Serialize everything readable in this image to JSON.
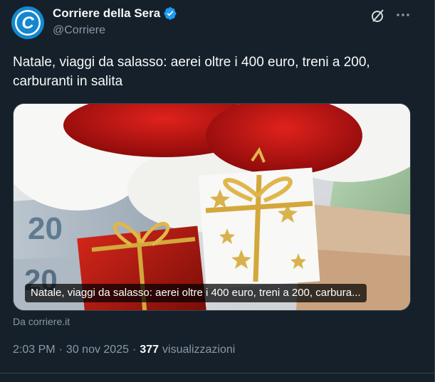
{
  "author": {
    "name": "Corriere della Sera",
    "handle": "@Corriere",
    "avatar_letter": "C",
    "verified": true
  },
  "header_icons": [
    "grok-icon",
    "more-icon"
  ],
  "tweet": {
    "text": "Natale, viaggi da salasso: aerei oltre i 400 euro, treni a 200, carburanti in salita"
  },
  "card": {
    "caption": "Natale, viaggi da salasso: aerei oltre i 400 euro, treni a 200, carbura...",
    "source": "Da corriere.it",
    "banknote_label": "20"
  },
  "meta": {
    "time": "2:03 PM",
    "date": "30 nov 2025",
    "separator": "·",
    "views_count": "377",
    "views_label": "visualizzazioni"
  },
  "colors": {
    "background": "#15202b",
    "text_primary": "#f7f9f9",
    "text_secondary": "#8b98a5",
    "verified_blue": "#1d9bf0",
    "avatar_blue": "#0d7cc2"
  }
}
